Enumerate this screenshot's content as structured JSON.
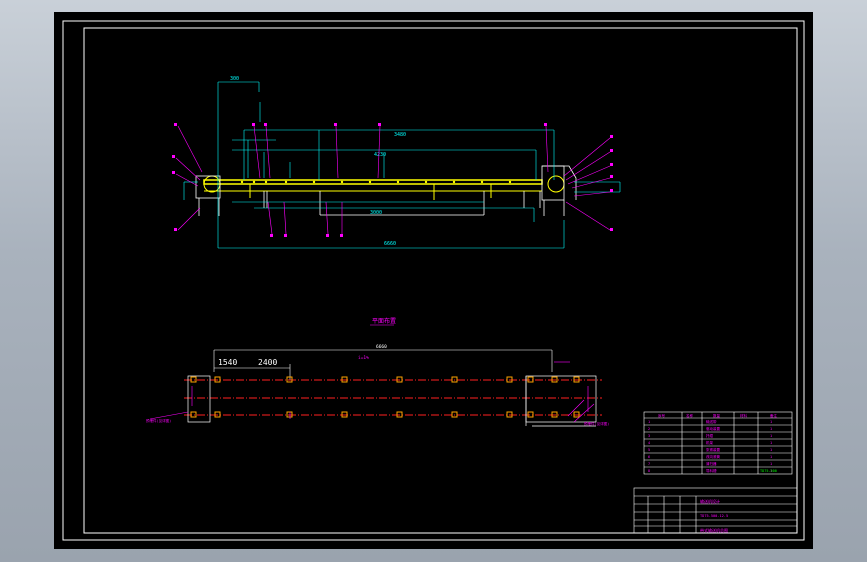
{
  "colors": {
    "frame": "#ffffff",
    "dimension": "#00ffff",
    "leader": "#ff00ff",
    "structure": "#ffff00",
    "centerline": "#ff2020",
    "pier": "#ffa500",
    "highlight": "#00ff00"
  },
  "elevation": {
    "overall_dim_label": "6660",
    "upper_dim_label": "3480",
    "mid_dim_label": "4230",
    "span_dim_label": "3000",
    "top_dim_label": "300"
  },
  "plan": {
    "title": "平面布置",
    "dim_1540": "1540",
    "dim_2400": "2400",
    "overall_dim_label": "6660",
    "slope_label": "i=1%",
    "left_note": "预埋件(见详图)",
    "right_note": "预埋件(见详图)"
  },
  "title_block": {
    "table_headers": [
      "序号",
      "名称",
      "数量",
      "材料",
      "备注"
    ],
    "rows": [
      [
        "1",
        "输送带",
        "1",
        "",
        ""
      ],
      [
        "2",
        "驱动装置",
        "1",
        "",
        ""
      ],
      [
        "3",
        "托辊",
        "1",
        "",
        ""
      ],
      [
        "4",
        "机架",
        "1",
        "",
        ""
      ],
      [
        "5",
        "张紧装置",
        "1",
        "",
        ""
      ],
      [
        "6",
        "改向滚筒",
        "1",
        "",
        ""
      ],
      [
        "7",
        "清扫器",
        "1",
        "",
        ""
      ],
      [
        "8",
        "导料槽",
        "1",
        "",
        ""
      ]
    ],
    "highlight_note": "TD75-500",
    "drawing_name": "带式输送机总图",
    "project": "输送机设计",
    "drawing_no": "TD75-500-12.5"
  }
}
